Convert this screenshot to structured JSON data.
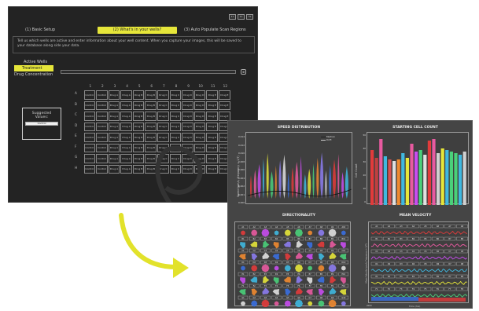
{
  "setup": {
    "steps": [
      "(1) Basic Setup",
      "(2) What's in your wells?",
      "(3) Auto Populate Scan Regions"
    ],
    "window_buttons": [
      "1x",
      "2x",
      "3x"
    ],
    "info_text": "Tell us which wells are active and enter information about your well content. When you capture your images, this will be saved to your database along side your data.",
    "modes": [
      "Active Wells",
      "Treatment",
      "Drug Concentration"
    ],
    "active_mode": "Treatment",
    "treatment_button": "⊕",
    "columns": [
      "1",
      "2",
      "3",
      "4",
      "5",
      "6",
      "7",
      "8",
      "9",
      "10",
      "11",
      "12"
    ],
    "rows": [
      "A",
      "B",
      "C",
      "D",
      "E",
      "F",
      "G",
      "H"
    ],
    "wells": [
      "Control",
      "Control",
      "Drug A",
      "Drug A",
      "Drug B",
      "Drug B",
      "Drug C",
      "Drug C",
      "Drug D",
      "Drug D",
      "Drug E",
      "Drug E"
    ],
    "suggested_title": "Suggested Values:",
    "suggested_button": "Control"
  },
  "dashboard": {
    "speed_title": "SPEED DISTRIBUTION",
    "speed_ylabel": "Speed (μm/s, Frequency = 1/T)",
    "speed_legend": [
      "Median",
      "Drift"
    ],
    "speed_yticks": [
      "0.014",
      "0.012",
      "0.010",
      "0.008",
      "0.006",
      "0.004",
      "0.002",
      "0.001",
      "0.000"
    ],
    "cell_title": "STARTING CELL COUNT",
    "cell_ylabel": "Cell Count",
    "cell_yticks": [
      "50",
      "40",
      "30",
      "20",
      "10",
      "0"
    ],
    "dir_title": "DIRECTIONALITY",
    "dir_row_labels": [
      [
        "A1",
        "A2",
        "A3",
        "A4",
        "A5",
        "A6",
        "A7",
        "A8",
        "A9",
        "A10"
      ],
      [
        "B1",
        "B2",
        "B3",
        "B4",
        "B5",
        "B6",
        "B7",
        "B8",
        "B9",
        "B10"
      ],
      [
        "C1",
        "C2",
        "C3",
        "C4",
        "C5",
        "C6",
        "C7",
        "C8",
        "C9",
        "C10"
      ],
      [
        "D1",
        "D2",
        "D3",
        "D4",
        "D5",
        "D6",
        "D7",
        "D8",
        "D9",
        "D10"
      ],
      [
        "E1",
        "E2",
        "E3",
        "E4",
        "E5",
        "E6",
        "E7",
        "E8",
        "E9",
        "E10"
      ],
      [
        "F1",
        "F2",
        "F3",
        "F4",
        "F5",
        "F6",
        "F7",
        "F8",
        "F9",
        "F10"
      ],
      [
        "G1",
        "G2",
        "G3",
        "G4",
        "G5",
        "G6",
        "G7",
        "G8",
        "G9",
        "G10"
      ]
    ],
    "vel_title": "MEAN VELOCITY",
    "vel_ylabel": "Mean Velocity (μm/s, Frequency = 1/T)",
    "vel_xlabel": "Time (hrs)",
    "vel_xticks": [
      "0",
      "2000",
      "4000"
    ],
    "vel_row_labels": [
      [
        "A1",
        "A2",
        "A3",
        "A4",
        "A5",
        "A6",
        "A7",
        "A8"
      ],
      [
        "B1",
        "B2",
        "B3",
        "B4",
        "B5",
        "B6",
        "B7",
        "B8"
      ],
      [
        "C1",
        "C2",
        "C3",
        "C4",
        "C5",
        "C6",
        "C7",
        "C8"
      ],
      [
        "D1",
        "D2",
        "D3",
        "D4",
        "D5",
        "D6",
        "D7",
        "D8"
      ],
      [
        "E1",
        "E2",
        "E3",
        "E4",
        "E5",
        "E6",
        "E7",
        "E8"
      ],
      [
        "F1",
        "F2",
        "F3",
        "F4",
        "F5",
        "F6",
        "F7",
        "F8"
      ]
    ],
    "palette": [
      "#e23b3b",
      "#e85aa0",
      "#c84cf0",
      "#3fb8e0",
      "#e6e63a",
      "#4ad07a",
      "#f08a30",
      "#8c7cf0",
      "#e0e0e0",
      "#3a6fe0"
    ]
  }
}
